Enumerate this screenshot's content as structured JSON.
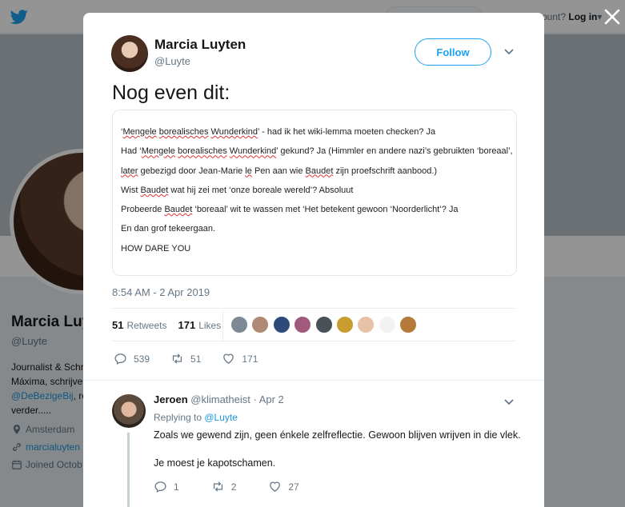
{
  "background": {
    "account_prompt": "ount?",
    "login_label": "Log in",
    "profile_name": "Marcia Luy",
    "profile_handle": "@Luyte",
    "bio_line1": "Journalist & Schr",
    "bio_line2": "Máxima, schrijve",
    "bio_mention": "@DeBezigeBij",
    "bio_line3_suffix": ", re",
    "bio_line4": "verder.....",
    "location": "Amsterdam",
    "website": "marcialuyten",
    "joined": "Joined Octob"
  },
  "tweet": {
    "author_name": "Marcia Luyten",
    "author_handle": "@Luyte",
    "follow_label": "Follow",
    "text": "Nog even dit:",
    "timestamp": "8:54 AM - 2 Apr 2019",
    "retweets_count": "51",
    "retweets_label": "Retweets",
    "likes_count": "171",
    "likes_label": "Likes",
    "reply_count": "539",
    "retweet_count": "51",
    "like_count": "171"
  },
  "media_lines": {
    "l1_pre": "‘",
    "l1_w1": "Mengele",
    "l1_sp1": " ",
    "l1_w2": "borealisches",
    "l1_sp2": " ",
    "l1_w3": "Wunderkind",
    "l1_post": "’ - had ik het wiki-lemma moeten checken? Ja",
    "l2_pre": "Had ‘",
    "l2_w1": "Mengele",
    "l2_sp1": " ",
    "l2_w2": "borealisches",
    "l2_sp2": " ",
    "l2_w3": "Wunderkind",
    "l2_post": "’ gekund? Ja (Himmler en andere nazi’s gebruikten ‘boreaal’,",
    "l3_w1": "later",
    "l3_mid1": " gebezigd door Jean-Marie ",
    "l3_w2": "le",
    "l3_mid2": " Pen aan wie ",
    "l3_w3": "Baudet",
    "l3_post": " zijn proefschrift aanbood.)",
    "l4_pre": "Wist ",
    "l4_w1": "Baudet",
    "l4_post": " wat hij zei met ‘onze boreale wereld’? Absoluut",
    "l5_pre": "Probeerde ",
    "l5_w1": "Baudet",
    "l5_post": " ‘boreaal’ wit te wassen met ‘Het betekent gewoon ‘Noorderlicht’? Ja",
    "l6": "En dan grof tekeergaan.",
    "l7": "HOW DARE YOU"
  },
  "likers": [
    {
      "name": "liker-1",
      "color": "#7d8a95"
    },
    {
      "name": "liker-2",
      "color": "#b08a74"
    },
    {
      "name": "liker-3",
      "color": "#2d4a78"
    },
    {
      "name": "liker-4",
      "color": "#a05a7c"
    },
    {
      "name": "liker-5",
      "color": "#4a5058"
    },
    {
      "name": "liker-6",
      "color": "#c89c2e"
    },
    {
      "name": "liker-7",
      "color": "#e8c2a8"
    },
    {
      "name": "liker-8",
      "color": "#f2f2f2"
    },
    {
      "name": "liker-9",
      "color": "#b47a3a"
    }
  ],
  "reply": {
    "author_name": "Jeroen",
    "author_handle": "@klimatheist",
    "separator": " · ",
    "date": "Apr 2",
    "replying_to_label": "Replying to ",
    "replying_to_handle": "@Luyte",
    "text_line1": "Zoals we gewend zijn, geen énkele zelfreflectie. Gewoon blijven wrijven in die vlek.",
    "text_line2": "Je moest je kapotschamen.",
    "reply_count": "1",
    "retweet_count": "2",
    "like_count": "27"
  },
  "colors": {
    "accent": "#1da1f2",
    "link": "#1b95e0",
    "muted": "#657786"
  }
}
